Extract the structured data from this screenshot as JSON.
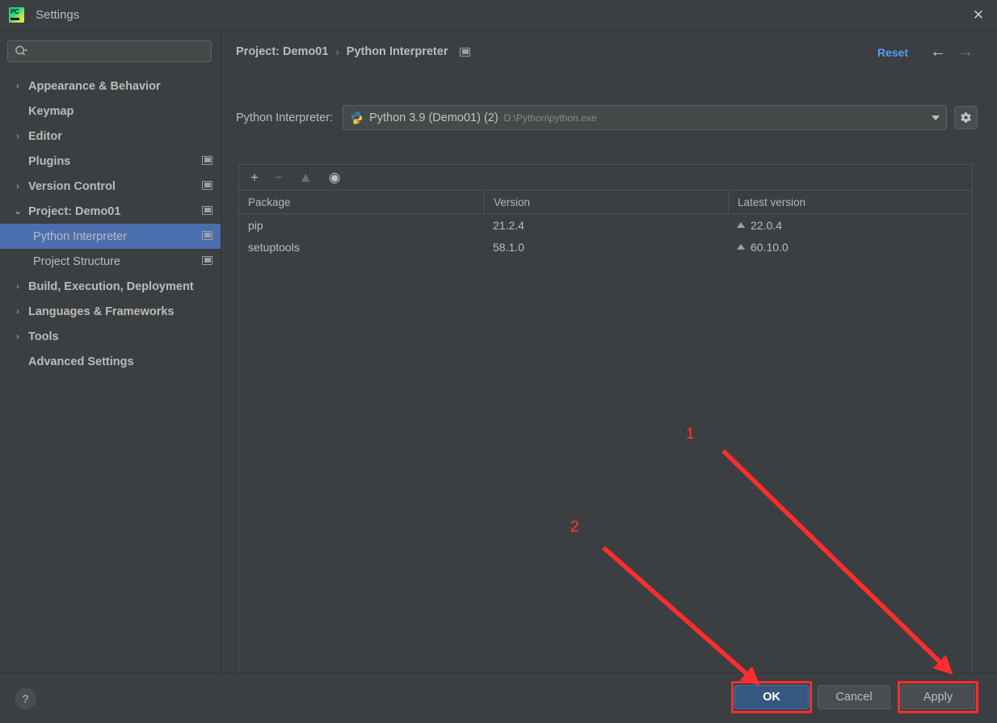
{
  "window": {
    "title": "Settings",
    "app_icon": "pycharm-icon",
    "close_label": "✕"
  },
  "sidebar": {
    "search": {
      "placeholder": "",
      "value": "",
      "icon": "search-icon"
    },
    "items": [
      {
        "label": "Appearance & Behavior",
        "arrow": "›",
        "bold": true,
        "indent": false,
        "selected": false,
        "monitor": false
      },
      {
        "label": "Keymap",
        "arrow": "",
        "bold": true,
        "indent": false,
        "selected": false,
        "monitor": false
      },
      {
        "label": "Editor",
        "arrow": "›",
        "bold": true,
        "indent": false,
        "selected": false,
        "monitor": false
      },
      {
        "label": "Plugins",
        "arrow": "",
        "bold": true,
        "indent": false,
        "selected": false,
        "monitor": true
      },
      {
        "label": "Version Control",
        "arrow": "›",
        "bold": true,
        "indent": false,
        "selected": false,
        "monitor": true
      },
      {
        "label": "Project: Demo01",
        "arrow": "⌄",
        "bold": true,
        "indent": false,
        "selected": false,
        "monitor": true
      },
      {
        "label": "Python Interpreter",
        "arrow": "",
        "bold": false,
        "indent": true,
        "selected": true,
        "monitor": true
      },
      {
        "label": "Project Structure",
        "arrow": "",
        "bold": false,
        "indent": true,
        "selected": false,
        "monitor": true
      },
      {
        "label": "Build, Execution, Deployment",
        "arrow": "›",
        "bold": true,
        "indent": false,
        "selected": false,
        "monitor": false
      },
      {
        "label": "Languages & Frameworks",
        "arrow": "›",
        "bold": true,
        "indent": false,
        "selected": false,
        "monitor": false
      },
      {
        "label": "Tools",
        "arrow": "›",
        "bold": true,
        "indent": false,
        "selected": false,
        "monitor": false
      },
      {
        "label": "Advanced Settings",
        "arrow": "",
        "bold": true,
        "indent": false,
        "selected": false,
        "monitor": false
      }
    ]
  },
  "main": {
    "breadcrumb": {
      "root": "Project: Demo01",
      "separator": "›",
      "leaf": "Python Interpreter"
    },
    "reset_label": "Reset",
    "nav": {
      "back": "←",
      "forward": "→"
    },
    "interpreter": {
      "label": "Python Interpreter:",
      "icon": "python-logo-icon",
      "name": "Python 3.9 (Demo01) (2)",
      "path": "D:\\Python\\python.exe",
      "settings_icon": "gear-icon"
    },
    "packages": {
      "toolbar": [
        {
          "name": "add-package-button",
          "glyph": "+",
          "enabled": true
        },
        {
          "name": "remove-package-button",
          "glyph": "−",
          "enabled": false
        },
        {
          "name": "upgrade-package-button",
          "glyph": "▲",
          "enabled": false
        },
        {
          "name": "show-early-releases-button",
          "glyph": "◉",
          "enabled": true
        }
      ],
      "columns": [
        "Package",
        "Version",
        "Latest version"
      ],
      "rows": [
        {
          "package": "pip",
          "version": "21.2.4",
          "latest": "22.0.4",
          "upgradable": true
        },
        {
          "package": "setuptools",
          "version": "58.1.0",
          "latest": "60.10.0",
          "upgradable": true
        }
      ]
    }
  },
  "footer": {
    "help_label": "?",
    "buttons": [
      {
        "name": "ok-button",
        "label": "OK",
        "primary": true
      },
      {
        "name": "cancel-button",
        "label": "Cancel",
        "primary": false
      },
      {
        "name": "apply-button",
        "label": "Apply",
        "primary": false
      }
    ]
  },
  "annotations": {
    "color": "#ff2d2d",
    "markers": [
      {
        "number": "1",
        "points_to": "apply-button"
      },
      {
        "number": "2",
        "points_to": "ok-button"
      }
    ]
  }
}
